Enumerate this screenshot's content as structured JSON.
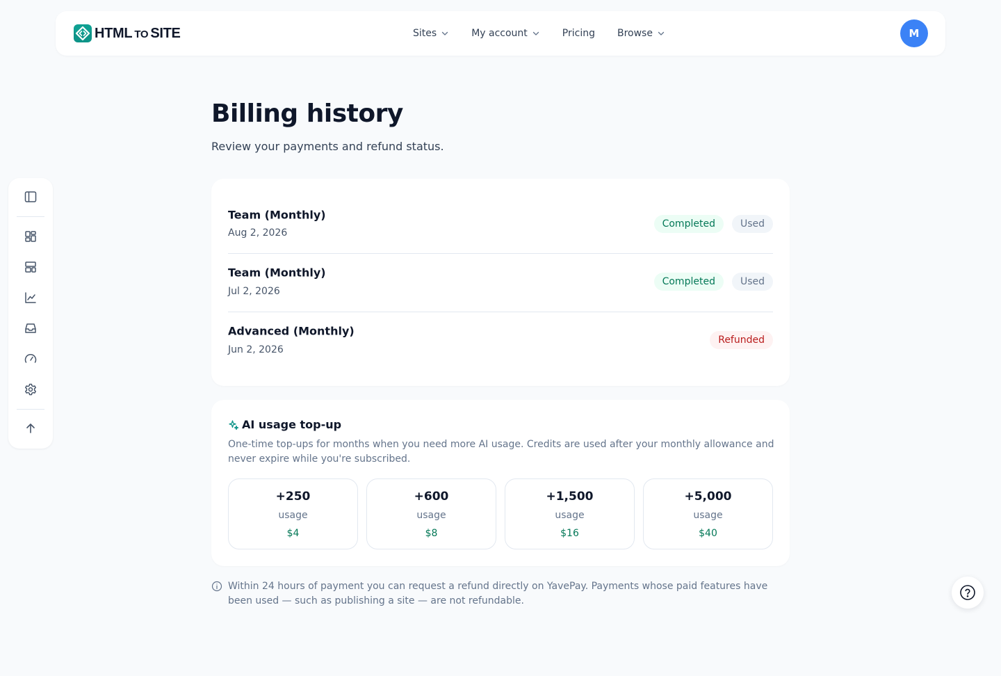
{
  "brand": {
    "name_part1": "HTML",
    "name_part2": "TO",
    "name_part3": "SITE",
    "accent_color": "#0d9488"
  },
  "nav": {
    "links": [
      {
        "label": "Sites",
        "has_dropdown": true
      },
      {
        "label": "My account",
        "has_dropdown": true
      },
      {
        "label": "Pricing",
        "has_dropdown": false
      },
      {
        "label": "Browse",
        "has_dropdown": true
      }
    ],
    "avatar_initial": "M",
    "avatar_color": "#3b82f6"
  },
  "sidebar": {
    "items": [
      {
        "icon": "sidebar-toggle-icon"
      },
      {
        "icon": "dashboard-grid-icon"
      },
      {
        "icon": "layout-template-icon"
      },
      {
        "icon": "line-chart-icon"
      },
      {
        "icon": "inbox-icon"
      },
      {
        "icon": "gauge-icon"
      },
      {
        "icon": "gear-icon"
      },
      {
        "icon": "arrow-up-icon"
      }
    ]
  },
  "page": {
    "title": "Billing history",
    "subtitle": "Review your payments and refund status."
  },
  "billing": {
    "rows": [
      {
        "plan": "Team (Monthly)",
        "date": "Aug 2, 2026",
        "status": "Completed",
        "usage": "Used"
      },
      {
        "plan": "Team (Monthly)",
        "date": "Jul 2, 2026",
        "status": "Completed",
        "usage": "Used"
      },
      {
        "plan": "Advanced (Monthly)",
        "date": "Jun 2, 2026",
        "status": "Refunded",
        "usage": ""
      }
    ]
  },
  "topup": {
    "title": "AI usage top-up",
    "description": "One-time top-ups for months when you need more AI usage. Credits are used after your monthly allowance and never expire while you're subscribed.",
    "options": [
      {
        "amount": "+250",
        "unit": "usage",
        "price": "$4"
      },
      {
        "amount": "+600",
        "unit": "usage",
        "price": "$8"
      },
      {
        "amount": "+1,500",
        "unit": "usage",
        "price": "$16"
      },
      {
        "amount": "+5,000",
        "unit": "usage",
        "price": "$40"
      }
    ]
  },
  "note": {
    "text": "Within 24 hours of payment you can request a refund directly on YavePay. Payments whose paid features have been used — such as publishing a site — are not refundable."
  },
  "colors": {
    "completed_bg": "#ecfdf5",
    "completed_text": "#047857",
    "refunded_bg": "#fef2f2",
    "refunded_text": "#b91c1c",
    "used_bg": "#f1f5f9",
    "used_text": "#64748b"
  }
}
